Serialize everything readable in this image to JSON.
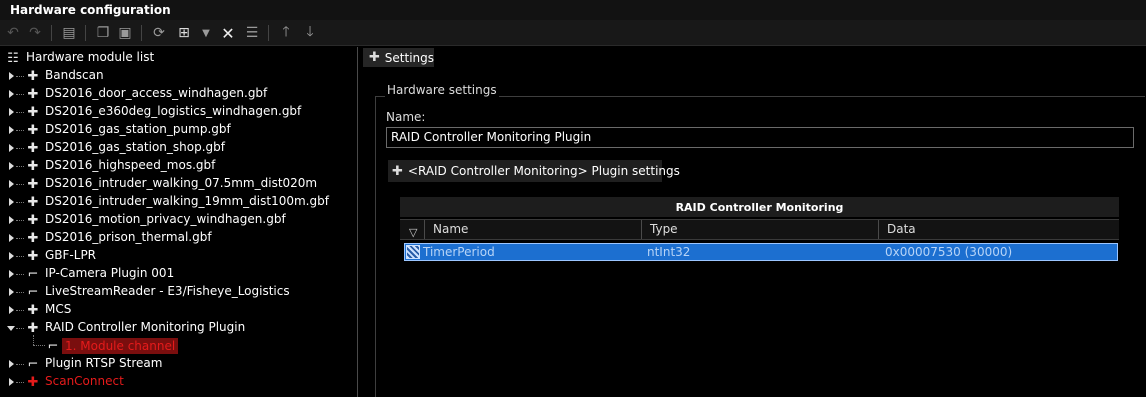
{
  "window": {
    "title": "Hardware configuration"
  },
  "toolbar": {
    "buttons": [
      "undo-icon",
      "redo-icon",
      "print-icon",
      "copy-icon",
      "paste-icon",
      "refresh-icon",
      "add-icon",
      "dropdown-icon",
      "delete-icon",
      "properties-icon",
      "move-up-icon",
      "move-down-icon"
    ]
  },
  "tree": {
    "root_label": "Hardware module list",
    "items": [
      {
        "label": "Bandscan",
        "icon": "puzzle-icon",
        "red": false
      },
      {
        "label": "DS2016_door_access_windhagen.gbf",
        "icon": "puzzle-icon",
        "red": false
      },
      {
        "label": "DS2016_e360deg_logistics_windhagen.gbf",
        "icon": "puzzle-icon",
        "red": false
      },
      {
        "label": "DS2016_gas_station_pump.gbf",
        "icon": "puzzle-icon",
        "red": false
      },
      {
        "label": "DS2016_gas_station_shop.gbf",
        "icon": "puzzle-icon",
        "red": false
      },
      {
        "label": "DS2016_highspeed_mos.gbf",
        "icon": "puzzle-icon",
        "red": false
      },
      {
        "label": "DS2016_intruder_walking_07.5mm_dist020m",
        "icon": "puzzle-icon",
        "red": false
      },
      {
        "label": "DS2016_intruder_walking_19mm_dist100m.gbf",
        "icon": "puzzle-icon",
        "red": false
      },
      {
        "label": "DS2016_motion_privacy_windhagen.gbf",
        "icon": "puzzle-icon",
        "red": false
      },
      {
        "label": "DS2016_prison_thermal.gbf",
        "icon": "puzzle-icon",
        "red": false
      },
      {
        "label": "GBF-LPR",
        "icon": "puzzle-icon",
        "red": false
      },
      {
        "label": "IP-Camera Plugin 001",
        "icon": "camera-icon",
        "red": false
      },
      {
        "label": "LiveStreamReader - E3/Fisheye_Logistics",
        "icon": "camera-icon",
        "red": false
      },
      {
        "label": "MCS",
        "icon": "puzzle-icon",
        "red": false
      },
      {
        "label": "RAID Controller Monitoring Plugin",
        "icon": "puzzle-icon",
        "red": false,
        "expanded": true
      },
      {
        "label": "Plugin RTSP Stream",
        "icon": "camera-icon",
        "red": false
      },
      {
        "label": "ScanConnect",
        "icon": "puzzle-icon",
        "red": true
      }
    ],
    "child": {
      "label": "1. Module channel",
      "icon": "camera-icon"
    }
  },
  "settings": {
    "tab_label": "Settings",
    "group_title": "Hardware settings",
    "name_label": "Name:",
    "name_value": "RAID Controller Monitoring Plugin",
    "plugin_button": "<RAID Controller Monitoring> Plugin settings"
  },
  "table": {
    "title": "RAID Controller Monitoring",
    "columns": [
      "Name",
      "Type",
      "Data"
    ],
    "rows": [
      {
        "name": "TimerPeriod",
        "type": "ntInt32",
        "data": "0x00007530 (30000)"
      }
    ]
  }
}
